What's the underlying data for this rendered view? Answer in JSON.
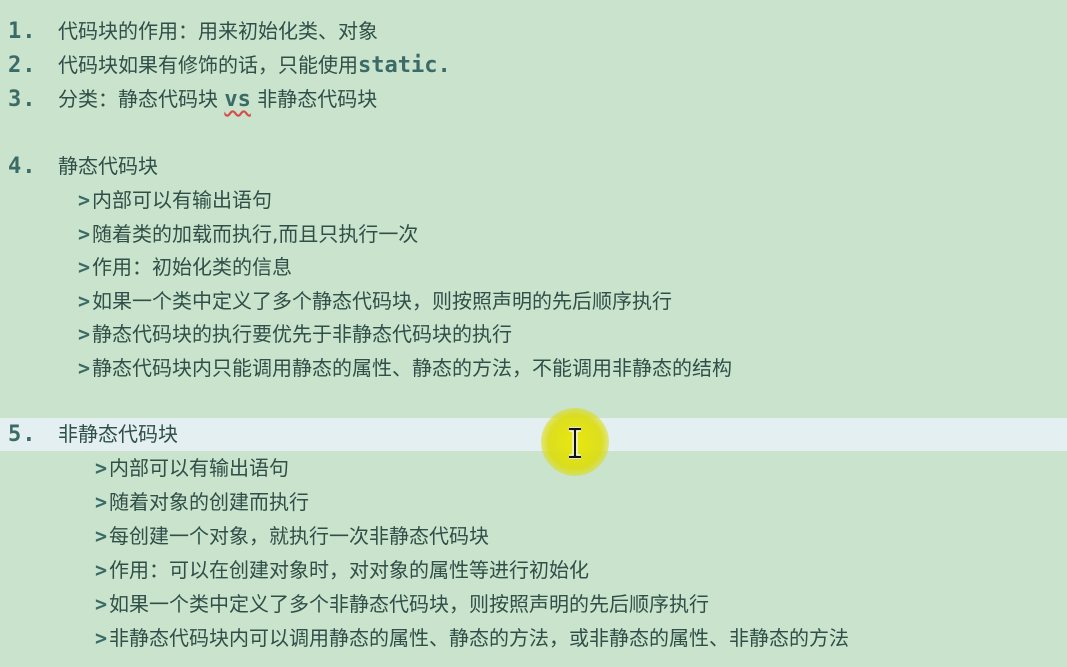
{
  "lines": [
    {
      "num": "1.",
      "text": "代码块的作用：用来初始化类、对象"
    },
    {
      "num": "2.",
      "text": "代码块如果有修饰的话，只能使用",
      "code": "static."
    },
    {
      "num": "3.",
      "text_before": "分类：静态代码块 ",
      "vs": "vs",
      "text_after": " 非静态代码块"
    },
    {
      "num": "4.",
      "text": "静态代码块"
    },
    {
      "num": "5.",
      "text": "非静态代码块"
    }
  ],
  "static_block": {
    "marker": ">",
    "items": [
      "内部可以有输出语句",
      "随着类的加载而执行,而且只执行一次",
      "作用：初始化类的信息",
      "如果一个类中定义了多个静态代码块，则按照声明的先后顺序执行",
      "静态代码块的执行要优先于非静态代码块的执行",
      "静态代码块内只能调用静态的属性、静态的方法，不能调用非静态的结构"
    ]
  },
  "nonstatic_block": {
    "marker": ">",
    "items": [
      "内部可以有输出语句",
      "随着对象的创建而执行",
      "每创建一个对象，就执行一次非静态代码块",
      "作用：可以在创建对象时，对对象的属性等进行初始化",
      "如果一个类中定义了多个非静态代码块，则按照声明的先后顺序执行",
      "非静态代码块内可以调用静态的属性、静态的方法，或非静态的属性、非静态的方法"
    ]
  },
  "cursor": {
    "icon": "text-cursor-icon",
    "highlight_color": "#e3e300"
  }
}
